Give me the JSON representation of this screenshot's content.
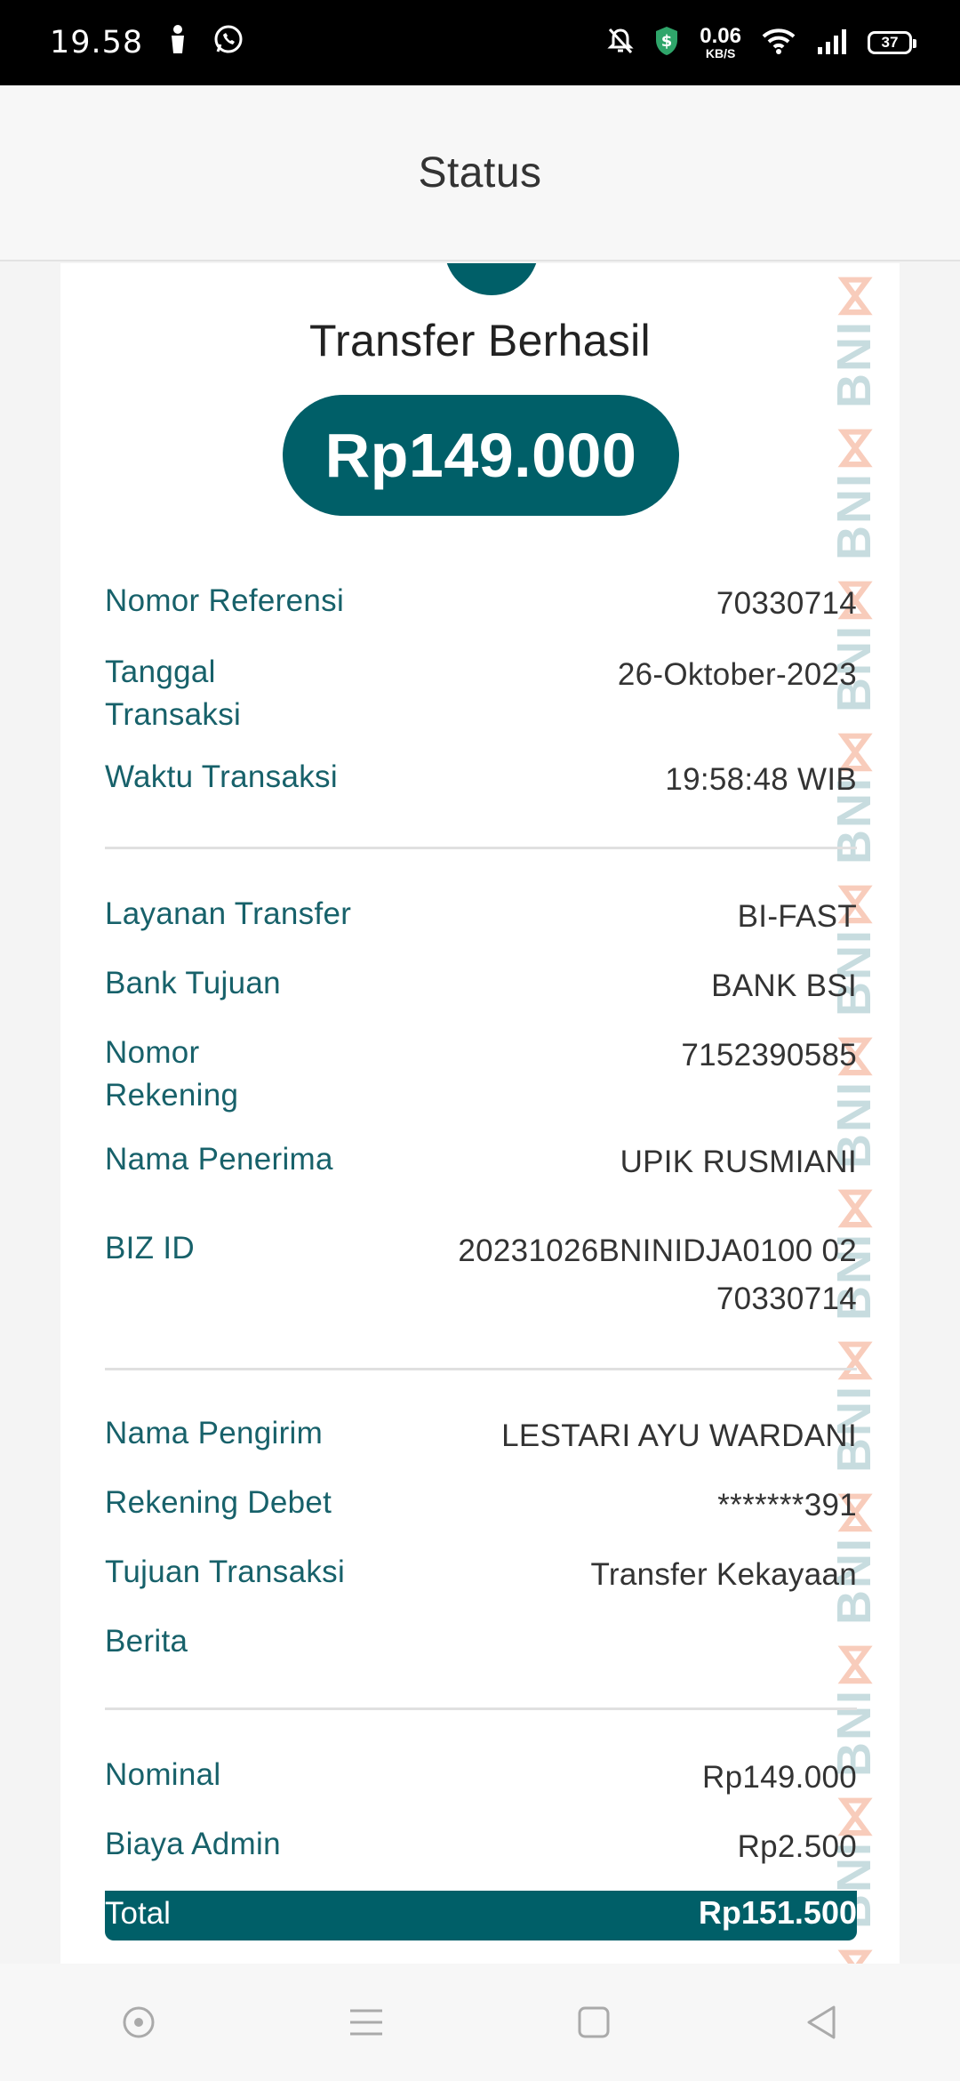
{
  "status_bar": {
    "time": "19.58",
    "net_speed": "0.06",
    "net_unit": "KB/S",
    "battery": "37"
  },
  "header": {
    "title": "Status"
  },
  "receipt": {
    "title": "Transfer Berhasil",
    "amount": "Rp149.000",
    "section1": [
      {
        "label": "Nomor Referensi",
        "value": "70330714"
      },
      {
        "label": "Tanggal Transaksi",
        "value": "26-Oktober-2023"
      },
      {
        "label": "Waktu Transaksi",
        "value": "19:58:48 WIB"
      }
    ],
    "section2": [
      {
        "label": "Layanan Transfer",
        "value": "BI-FAST"
      },
      {
        "label": "Bank Tujuan",
        "value": "BANK BSI"
      },
      {
        "label": "Nomor Rekening",
        "value": "7152390585"
      },
      {
        "label": "Nama Penerima",
        "value": "UPIK RUSMIANI"
      },
      {
        "label": "BIZ ID",
        "value": "20231026BNINIDJA0100 0270330714"
      }
    ],
    "section3": [
      {
        "label": "Nama Pengirim",
        "value": "LESTARI AYU WARDANI"
      },
      {
        "label": "Rekening Debet",
        "value": "*******391"
      },
      {
        "label": "Tujuan Transaksi",
        "value": "Transfer Kekayaan"
      },
      {
        "label": "Berita",
        "value": ""
      }
    ],
    "section4": [
      {
        "label": "Nominal",
        "value": "Rp149.000"
      },
      {
        "label": "Biaya Admin",
        "value": "Rp2.500"
      }
    ],
    "total": {
      "label": "Total",
      "value": "Rp151.500"
    },
    "watermark_text": "BNI"
  },
  "colors": {
    "brand_teal": "#005f68",
    "label_teal": "#17616a",
    "watermark_orange": "#eb6e3c"
  },
  "nav": {
    "icons": [
      "assistant-dot-icon",
      "menu-lines-icon",
      "home-square-icon",
      "back-triangle-icon"
    ]
  }
}
